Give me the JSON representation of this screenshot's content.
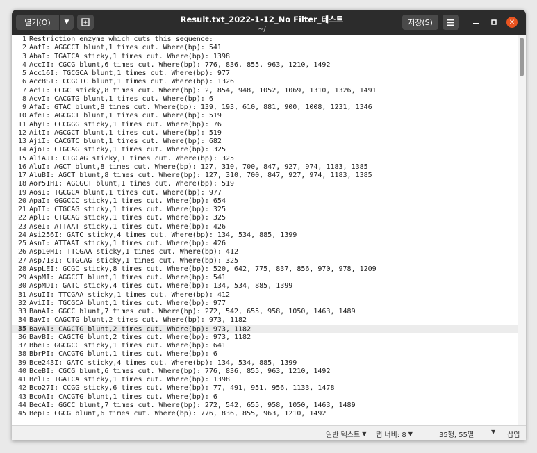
{
  "window": {
    "title": "Result.txt_2022-1-12_No Filter_테스트",
    "path": "~/",
    "open_label": "열기(O)",
    "open_dropdown_icon": "chevron-down-icon",
    "new_tab_icon": "new-tab-icon",
    "save_label": "저장(S)",
    "menu_icon": "hamburger-menu-icon",
    "minimize_icon": "minimize-icon",
    "maximize_icon": "maximize-icon",
    "close_icon": "close-icon",
    "close_color": "#e95420"
  },
  "editor": {
    "current_line": 35,
    "lines": [
      {
        "n": "1",
        "text": "Restriction enzyme which cuts this sequence:"
      },
      {
        "n": "2",
        "text": "AatI: AGGCCT blunt,1 times cut. Where(bp): 541"
      },
      {
        "n": "3",
        "text": "AbaI: TGATCA sticky,1 times cut. Where(bp): 1398"
      },
      {
        "n": "4",
        "text": "AccII: CGCG blunt,6 times cut. Where(bp): 776, 836, 855, 963, 1210, 1492"
      },
      {
        "n": "5",
        "text": "Acc16I: TGCGCA blunt,1 times cut. Where(bp): 977"
      },
      {
        "n": "6",
        "text": "AccBSI: CCGCTC blunt,1 times cut. Where(bp): 1326"
      },
      {
        "n": "7",
        "text": "AciI: CCGC sticky,8 times cut. Where(bp): 2, 854, 948, 1052, 1069, 1310, 1326, 1491"
      },
      {
        "n": "8",
        "text": "AcvI: CACGTG blunt,1 times cut. Where(bp): 6"
      },
      {
        "n": "9",
        "text": "AfaI: GTAC blunt,8 times cut. Where(bp): 139, 193, 610, 881, 900, 1008, 1231, 1346"
      },
      {
        "n": "10",
        "text": "AfeI: AGCGCT blunt,1 times cut. Where(bp): 519"
      },
      {
        "n": "11",
        "text": "AhyI: CCCGGG sticky,1 times cut. Where(bp): 76"
      },
      {
        "n": "12",
        "text": "AitI: AGCGCT blunt,1 times cut. Where(bp): 519"
      },
      {
        "n": "13",
        "text": "AjiI: CACGTC blunt,1 times cut. Where(bp): 682"
      },
      {
        "n": "14",
        "text": "AjoI: CTGCAG sticky,1 times cut. Where(bp): 325"
      },
      {
        "n": "15",
        "text": "AliAJI: CTGCAG sticky,1 times cut. Where(bp): 325"
      },
      {
        "n": "16",
        "text": "AluI: AGCT blunt,8 times cut. Where(bp): 127, 310, 700, 847, 927, 974, 1183, 1385"
      },
      {
        "n": "17",
        "text": "AluBI: AGCT blunt,8 times cut. Where(bp): 127, 310, 700, 847, 927, 974, 1183, 1385"
      },
      {
        "n": "18",
        "text": "Aor51HI: AGCGCT blunt,1 times cut. Where(bp): 519"
      },
      {
        "n": "19",
        "text": "AosI: TGCGCA blunt,1 times cut. Where(bp): 977"
      },
      {
        "n": "20",
        "text": "ApaI: GGGCCC sticky,1 times cut. Where(bp): 654"
      },
      {
        "n": "21",
        "text": "ApII: CTGCAG sticky,1 times cut. Where(bp): 325"
      },
      {
        "n": "22",
        "text": "AplI: CTGCAG sticky,1 times cut. Where(bp): 325"
      },
      {
        "n": "23",
        "text": "AseI: ATTAAT sticky,1 times cut. Where(bp): 426"
      },
      {
        "n": "24",
        "text": "Asi256I: GATC sticky,4 times cut. Where(bp): 134, 534, 885, 1399"
      },
      {
        "n": "25",
        "text": "AsnI: ATTAAT sticky,1 times cut. Where(bp): 426"
      },
      {
        "n": "26",
        "text": "Asp10HI: TTCGAA sticky,1 times cut. Where(bp): 412"
      },
      {
        "n": "27",
        "text": "Asp713I: CTGCAG sticky,1 times cut. Where(bp): 325"
      },
      {
        "n": "28",
        "text": "AspLEI: GCGC sticky,8 times cut. Where(bp): 520, 642, 775, 837, 856, 970, 978, 1209"
      },
      {
        "n": "29",
        "text": "AspMI: AGGCCT blunt,1 times cut. Where(bp): 541"
      },
      {
        "n": "30",
        "text": "AspMDI: GATC sticky,4 times cut. Where(bp): 134, 534, 885, 1399"
      },
      {
        "n": "31",
        "text": "AsuII: TTCGAA sticky,1 times cut. Where(bp): 412"
      },
      {
        "n": "32",
        "text": "AviII: TGCGCA blunt,1 times cut. Where(bp): 977"
      },
      {
        "n": "33",
        "text": "BanAI: GGCC blunt,7 times cut. Where(bp): 272, 542, 655, 958, 1050, 1463, 1489"
      },
      {
        "n": "34",
        "text": "BavI: CAGCTG blunt,2 times cut. Where(bp): 973, 1182"
      },
      {
        "n": "35",
        "text": "BavAI: CAGCTG blunt,2 times cut. Where(bp): 973, 1182"
      },
      {
        "n": "36",
        "text": "BavBI: CAGCTG blunt,2 times cut. Where(bp): 973, 1182"
      },
      {
        "n": "37",
        "text": "BbeI: GGCGCC sticky,1 times cut. Where(bp): 641"
      },
      {
        "n": "38",
        "text": "BbrPI: CACGTG blunt,1 times cut. Where(bp): 6"
      },
      {
        "n": "39",
        "text": "Bce243I: GATC sticky,4 times cut. Where(bp): 134, 534, 885, 1399"
      },
      {
        "n": "40",
        "text": "BceBI: CGCG blunt,6 times cut. Where(bp): 776, 836, 855, 963, 1210, 1492"
      },
      {
        "n": "41",
        "text": "BclI: TGATCA sticky,1 times cut. Where(bp): 1398"
      },
      {
        "n": "42",
        "text": "Bco27I: CCGG sticky,6 times cut. Where(bp): 77, 491, 951, 956, 1133, 1478"
      },
      {
        "n": "43",
        "text": "BcoAI: CACGTG blunt,1 times cut. Where(bp): 6"
      },
      {
        "n": "44",
        "text": "BecAI: GGCC blunt,7 times cut. Where(bp): 272, 542, 655, 958, 1050, 1463, 1489"
      },
      {
        "n": "45",
        "text": "BepI: CGCG blunt,6 times cut. Where(bp): 776, 836, 855, 963, 1210, 1492"
      }
    ]
  },
  "statusbar": {
    "language": "일반 텍스트",
    "tab_width": "탭 너비: 8",
    "position": "35행, 55열",
    "insert_mode": "삽입",
    "dropdown_icon": "triangle-down-icon"
  }
}
